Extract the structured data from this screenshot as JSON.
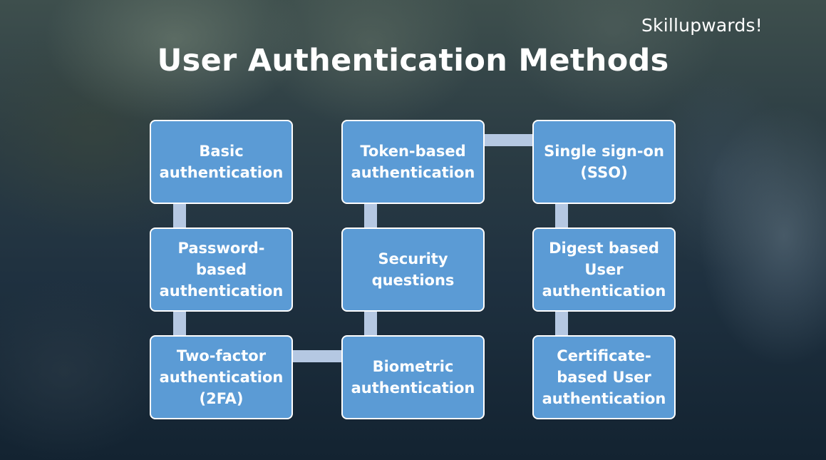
{
  "brand": "Skillupwards!",
  "title": "User Authentication Methods",
  "colors": {
    "node_fill": "#5b9bd5",
    "node_border": "#ffffff",
    "connector": "#b5c8e2",
    "text": "#ffffff"
  },
  "nodes": [
    {
      "label": "Basic authentication"
    },
    {
      "label": "Password-based authentication"
    },
    {
      "label": "Two-factor authentication (2FA)"
    },
    {
      "label": "Token-based authentication"
    },
    {
      "label": "Security questions"
    },
    {
      "label": "Biometric authentication"
    },
    {
      "label": "Single sign-on (SSO)"
    },
    {
      "label": "Digest based User authentication"
    },
    {
      "label": "Certificate-based User authentication"
    }
  ],
  "connections": [
    [
      "Basic authentication",
      "Password-based authentication"
    ],
    [
      "Password-based authentication",
      "Two-factor authentication (2FA)"
    ],
    [
      "Two-factor authentication (2FA)",
      "Biometric authentication"
    ],
    [
      "Biometric authentication",
      "Security questions"
    ],
    [
      "Security questions",
      "Token-based authentication"
    ],
    [
      "Token-based authentication",
      "Single sign-on (SSO)"
    ],
    [
      "Single sign-on (SSO)",
      "Digest based User authentication"
    ],
    [
      "Digest based User authentication",
      "Certificate-based User authentication"
    ]
  ]
}
